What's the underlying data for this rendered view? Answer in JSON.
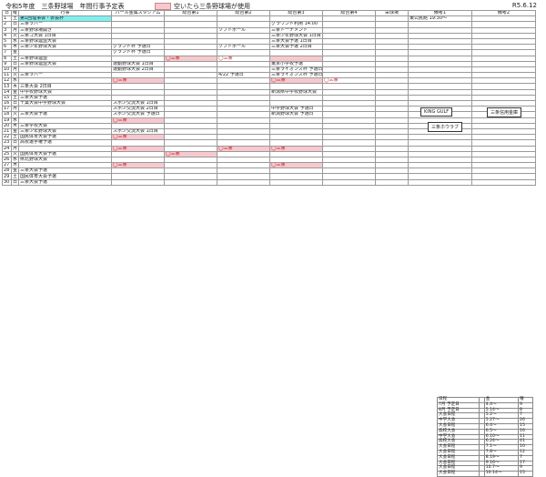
{
  "header": {
    "title": "令和5年度　三条野球場　年間行事予定表",
    "legend": "空いたら三条野球場が使用",
    "date": "R5.6.12"
  },
  "columns": [
    "日",
    "曜",
    "行事",
    "パール金属スタジアム",
    "総合第1",
    "総合第2",
    "総合第3",
    "総合第4",
    "栄球場",
    "備考1",
    "備考2"
  ],
  "rows": [
    {
      "d": "1",
      "w": "土",
      "event": "第1回理事会・表長杯",
      "c1": "",
      "c2": "",
      "c3": "",
      "c4": "",
      "c5": "",
      "c6": "",
      "r1": "東公民館 19:30〜",
      "r2": "",
      "hl": {
        "event": "cyan"
      }
    },
    {
      "d": "2",
      "w": "日",
      "event": "三条ラバー",
      "c1": "",
      "c2": "",
      "c3": "",
      "c4": "グラウンド利用 14:00",
      "c5": "",
      "c6": "",
      "r1": "",
      "r2": ""
    },
    {
      "d": "3",
      "w": "月",
      "event": "三条野球場開き",
      "c1": "",
      "c2": "",
      "c3": "ソフトボール",
      "c4": "三条トーナメント",
      "c5": "",
      "c6": "",
      "r1": "",
      "r2": ""
    },
    {
      "d": "4",
      "w": "火",
      "event": "三条ゴ大会 1日目",
      "c1": "",
      "c2": "",
      "c3": "",
      "c4": "三条少年野球大会 1日目",
      "c5": "",
      "c6": "",
      "r1": "",
      "r2": ""
    },
    {
      "d": "5",
      "w": "水",
      "event": "三条野球連盟大会",
      "c1": "",
      "c2": "",
      "c3": "",
      "c4": "三条大会予選 1日目",
      "c5": "",
      "c6": "",
      "r1": "",
      "r2": ""
    },
    {
      "d": "6",
      "w": "木",
      "event": "三条少年野球大会",
      "c1": "グランド杯 予選日",
      "c2": "",
      "c3": "ソフトボール",
      "c4": "三条大会予選 2日目",
      "c5": "",
      "c6": "",
      "r1": "",
      "r2": ""
    },
    {
      "d": "7",
      "w": "金",
      "event": "",
      "c1": "グランド杯 予選日",
      "c2": "",
      "c3": "",
      "c4": "",
      "c5": "",
      "c6": "",
      "r1": "",
      "r2": ""
    },
    {
      "d": "8",
      "w": "土",
      "event": "三条野球連盟",
      "c1": "",
      "c2": "◯三条",
      "c3": "◯三条",
      "c4": "",
      "c5": "",
      "c6": "",
      "r1": "",
      "r2": "",
      "hl": {
        "c2": "pink",
        "c4": "pink"
      }
    },
    {
      "d": "9",
      "w": "日",
      "event": "三条野球連盟大会",
      "c1": "運動野球大会 1日目",
      "c2": "",
      "c3": "",
      "c4": "東京小学校予選",
      "c5": "",
      "c6": "",
      "r1": "",
      "r2": ""
    },
    {
      "d": "10",
      "w": "月",
      "event": "",
      "c1": "運動野球大会 2日目",
      "c2": "",
      "c3": "",
      "c4": "三条ライオンズ杯 予選日",
      "c5": "",
      "c6": "",
      "r1": "",
      "r2": ""
    },
    {
      "d": "11",
      "w": "火",
      "event": "三条ラバー",
      "c1": "",
      "c2": "",
      "c3": "4/22 予選日",
      "c4": "三条ライオンズ杯 予選日",
      "c5": "",
      "c6": "",
      "r1": "",
      "r2": ""
    },
    {
      "d": "12",
      "w": "水",
      "event": "",
      "c1": "◯三条",
      "c2": "",
      "c3": "",
      "c4": "◯三条",
      "c5": "◯三条",
      "c6": "",
      "r1": "",
      "r2": "",
      "hl": {
        "c1": "pink",
        "c4": "pink"
      }
    },
    {
      "d": "13",
      "w": "木",
      "event": "三条大会 2日目",
      "c1": "",
      "c2": "",
      "c3": "",
      "c4": "",
      "c5": "",
      "c6": "",
      "r1": "",
      "r2": ""
    },
    {
      "d": "14",
      "w": "金",
      "event": "中学校野球大会",
      "c1": "",
      "c2": "",
      "c3": "",
      "c4": "新潟県中学校野球大会",
      "c5": "",
      "c6": "",
      "r1": "",
      "r2": ""
    },
    {
      "d": "15",
      "w": "土",
      "event": "三条大会予選",
      "c1": "",
      "c2": "",
      "c3": "",
      "c4": "",
      "c5": "",
      "c6": "",
      "r1": "",
      "r2": ""
    },
    {
      "d": "16",
      "w": "日",
      "event": "千葉大会中学野球大会",
      "c1": "スポ少交流大会 1日目",
      "c2": "",
      "c3": "",
      "c4": "",
      "c5": "",
      "c6": "",
      "r1": "",
      "r2": ""
    },
    {
      "d": "17",
      "w": "月",
      "event": "",
      "c1": "スポ少交流大会 2日目",
      "c2": "",
      "c3": "",
      "c4": "中学野球大会 予選日",
      "c5": "",
      "c6": "",
      "r1": "",
      "r2": ""
    },
    {
      "d": "18",
      "w": "火",
      "event": "三条大会予選",
      "c1": "スポ少交流大会 予選日",
      "c2": "",
      "c3": "",
      "c4": "新潟野球大会 予選日",
      "c5": "",
      "c6": "",
      "r1": "",
      "r2": ""
    },
    {
      "d": "19",
      "w": "水",
      "event": "",
      "c1": "◯三条",
      "c2": "",
      "c3": "",
      "c4": "",
      "c5": "",
      "c6": "",
      "r1": "",
      "r2": "",
      "hl": {
        "c1": "pink"
      }
    },
    {
      "d": "20",
      "w": "木",
      "event": "三条学校大会",
      "c1": "",
      "c2": "",
      "c3": "",
      "c4": "",
      "c5": "",
      "c6": "",
      "r1": "",
      "r2": ""
    },
    {
      "d": "21",
      "w": "金",
      "event": "三条少年野球大会",
      "c1": "スポ少交流大会 1日目",
      "c2": "",
      "c3": "",
      "c4": "",
      "c5": "",
      "c6": "",
      "r1": "",
      "r2": ""
    },
    {
      "d": "22",
      "w": "土",
      "event": "国民体育大会予選",
      "c1": "◯三条",
      "c2": "",
      "c3": "",
      "c4": "",
      "c5": "",
      "c6": "",
      "r1": "",
      "r2": "",
      "hl": {
        "c1": "pink"
      }
    },
    {
      "d": "23",
      "w": "日",
      "event": "高校選手権予選",
      "c1": "",
      "c2": "",
      "c3": "",
      "c4": "",
      "c5": "",
      "c6": "",
      "r1": "",
      "r2": ""
    },
    {
      "d": "24",
      "w": "月",
      "event": "",
      "c1": "◯三条",
      "c2": "",
      "c3": "◯三条",
      "c4": "◯三条",
      "c5": "",
      "c6": "",
      "r1": "",
      "r2": "",
      "hl": {
        "c1": "pink",
        "c3": "pink",
        "c4": "pink"
      }
    },
    {
      "d": "25",
      "w": "火",
      "event": "国民体育大会予選",
      "c1": "",
      "c2": "◯三条",
      "c3": "",
      "c4": "",
      "c5": "",
      "c6": "",
      "r1": "",
      "r2": "",
      "hl": {
        "c2": "pink"
      }
    },
    {
      "d": "26",
      "w": "水",
      "event": "県北野球大会",
      "c1": "",
      "c2": "",
      "c3": "",
      "c4": "",
      "c5": "",
      "c6": "",
      "r1": "",
      "r2": ""
    },
    {
      "d": "27",
      "w": "木",
      "event": "",
      "c1": "◯三条",
      "c2": "",
      "c3": "",
      "c4": "◯三条",
      "c5": "",
      "c6": "",
      "r1": "",
      "r2": "",
      "hl": {
        "c1": "pink",
        "c4": "pink"
      }
    },
    {
      "d": "28",
      "w": "金",
      "event": "三条大会予選",
      "c1": "",
      "c2": "",
      "c3": "",
      "c4": "",
      "c5": "",
      "c6": "",
      "r1": "",
      "r2": ""
    },
    {
      "d": "29",
      "w": "土",
      "event": "国民体育大会予選",
      "c1": "",
      "c2": "",
      "c3": "",
      "c4": "",
      "c5": "",
      "c6": "",
      "r1": "",
      "r2": ""
    },
    {
      "d": "30",
      "w": "日",
      "event": "三条大会予選",
      "c1": "",
      "c2": "",
      "c3": "",
      "c4": "",
      "c5": "",
      "c6": "",
      "r1": "",
      "r2": ""
    }
  ],
  "notes": [
    {
      "text": "KING GULF"
    },
    {
      "text": "三条信用金庫"
    },
    {
      "text": "三条ホウラブ"
    }
  ],
  "totals": {
    "header": [
      "日程",
      "",
      "金",
      "曜"
    ],
    "rows": [
      [
        "7月 予定日",
        "",
        "4.4〜",
        "9"
      ],
      [
        "8月 予定日",
        "",
        "5.14〜",
        "8"
      ],
      [
        "大会日程",
        "",
        "5.2〜",
        "7"
      ],
      [
        "中学大会",
        "",
        "5.27〜",
        "26"
      ],
      [
        "大会日程",
        "",
        "6.4〜",
        "15"
      ],
      [
        "高校大会",
        "",
        "6.5〜",
        "16"
      ],
      [
        "中学大会",
        "",
        "6.10〜",
        "11"
      ],
      [
        "高校大会",
        "",
        "6.24〜",
        "41"
      ],
      [
        "大会日程",
        "",
        "7.1〜",
        "10"
      ],
      [
        "大会日程",
        "",
        "7.8〜",
        "12"
      ],
      [
        "大会日程",
        "",
        "8.19〜",
        "7"
      ],
      [
        "大会日程",
        "",
        "9.16〜",
        "17"
      ],
      [
        "大会日程",
        "",
        "10.7〜",
        "9"
      ],
      [
        "大会日程",
        "",
        "10.14〜",
        "15"
      ]
    ]
  }
}
